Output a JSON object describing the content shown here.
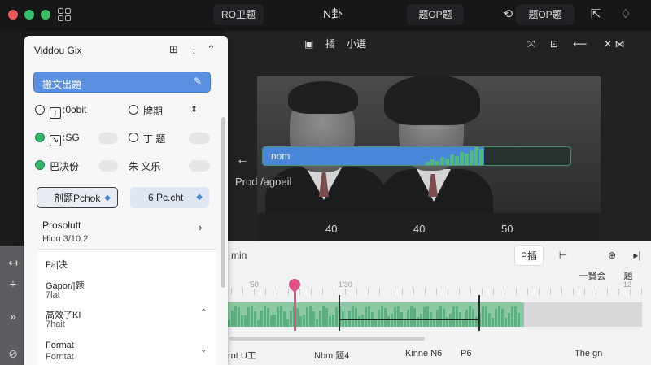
{
  "topbar": {
    "chip1": "RO卫题",
    "title": "N卦",
    "chip2": "题OP题",
    "chip3": "题OP题"
  },
  "editor": {
    "title": "Viddou Gix",
    "search_value": "搬文出題",
    "options": [
      {
        "label": ":0obit",
        "prefix": "↑"
      },
      {
        "label": "牌期"
      },
      {
        "label": ":SG",
        "prefix": "↘"
      },
      {
        "label": "丁 题"
      },
      {
        "label": "巴决份"
      },
      {
        "label": "朱 义乐"
      }
    ],
    "dropdown1": "剂题Pchok",
    "dropdown2": "6 Pc.cht",
    "section_title": "Prosolutt",
    "section_sub": "Hiou 3/10.2",
    "card_items": [
      {
        "title": "Fa|决",
        "sub": ""
      },
      {
        "title": "Gapor/|题",
        "sub": "7lat"
      },
      {
        "title": "高效了KI",
        "sub": "7hait"
      },
      {
        "title": "Format",
        "sub": "Forntat"
      }
    ]
  },
  "preview": {
    "toolbar_label1": "插",
    "toolbar_label2": "小選",
    "overlay_text": "nom",
    "prod_label": "Prod  /agoeil",
    "ruler": [
      "40",
      "40",
      "50"
    ]
  },
  "timeline": {
    "panel_label": "min",
    "btn_p": "P插",
    "label_a": "一賢会",
    "label_b": "題",
    "ruler_labels": [
      "'50",
      "1'30",
      "12"
    ],
    "footer": [
      "rnt U工",
      "Nbm 题4",
      "Kinne N6",
      "P6",
      "The gn"
    ]
  },
  "colors": {
    "accent_blue": "#4a86d8",
    "accent_green": "#33b56a",
    "playhead": "#e14f86"
  },
  "icons": [
    "grid-icon",
    "share-icon",
    "more-icon",
    "collapse-icon",
    "pen-icon",
    "chevron-right-icon",
    "back-arrow-icon",
    "bell-icon"
  ]
}
